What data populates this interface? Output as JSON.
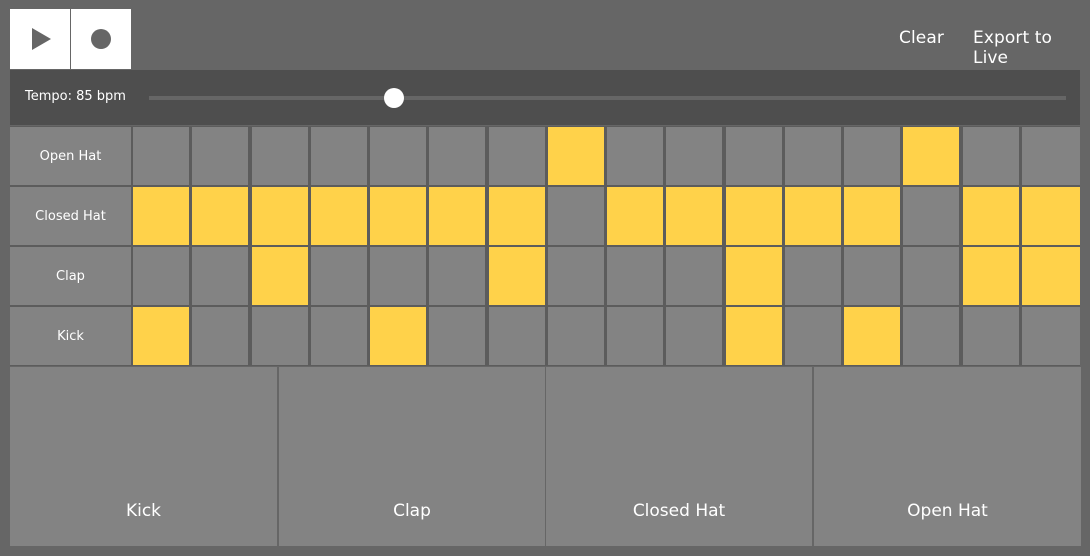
{
  "toolbar": {
    "play_icon": "play-icon",
    "record_icon": "record-icon",
    "clear_label": "Clear",
    "export_label": "Export to Live"
  },
  "tempo": {
    "label": "Tempo: 85 bpm",
    "bpm": 85,
    "slider_fraction": 0.267
  },
  "colors": {
    "background": "#666666",
    "tempo_bar": "#4e4e4e",
    "cell_off": "#838383",
    "cell_on": "#ffd24a",
    "button": "#ffffff"
  },
  "sequencer": {
    "steps": 16,
    "rows": [
      {
        "label": "Open Hat",
        "pattern": [
          0,
          0,
          0,
          0,
          0,
          0,
          0,
          1,
          0,
          0,
          0,
          0,
          0,
          1,
          0,
          0
        ]
      },
      {
        "label": "Closed Hat",
        "pattern": [
          1,
          1,
          1,
          1,
          1,
          1,
          1,
          0,
          1,
          1,
          1,
          1,
          1,
          0,
          1,
          1
        ]
      },
      {
        "label": "Clap",
        "pattern": [
          0,
          0,
          1,
          0,
          0,
          0,
          1,
          0,
          0,
          0,
          1,
          0,
          0,
          0,
          1,
          1
        ]
      },
      {
        "label": "Kick",
        "pattern": [
          1,
          0,
          0,
          0,
          1,
          0,
          0,
          0,
          0,
          0,
          1,
          0,
          1,
          0,
          0,
          0
        ]
      }
    ]
  },
  "pads": [
    {
      "label": "Kick"
    },
    {
      "label": "Clap"
    },
    {
      "label": "Closed Hat"
    },
    {
      "label": "Open Hat"
    }
  ]
}
